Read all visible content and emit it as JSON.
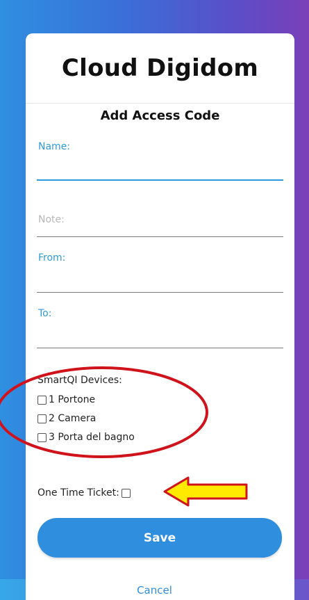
{
  "app": {
    "title": "Cloud Digidom"
  },
  "form": {
    "title": "Add Access Code",
    "fields": [
      {
        "label": "Name:",
        "value": ""
      },
      {
        "label": "Note:",
        "value": ""
      },
      {
        "label": "From:",
        "value": ""
      },
      {
        "label": "To:",
        "value": ""
      }
    ]
  },
  "devices": {
    "label": "SmartQI Devices:",
    "items": [
      {
        "label": "1 Portone",
        "checked": false
      },
      {
        "label": "2 Camera",
        "checked": false
      },
      {
        "label": "3 Porta del bagno",
        "checked": false
      }
    ]
  },
  "ticket": {
    "label": "One Time Ticket:",
    "checked": false
  },
  "actions": {
    "save_label": "Save",
    "cancel_label": "Cancel"
  },
  "colors": {
    "accent": "#2f8fde",
    "annotation_red": "#d0121b",
    "annotation_yellow": "#ffea00"
  }
}
